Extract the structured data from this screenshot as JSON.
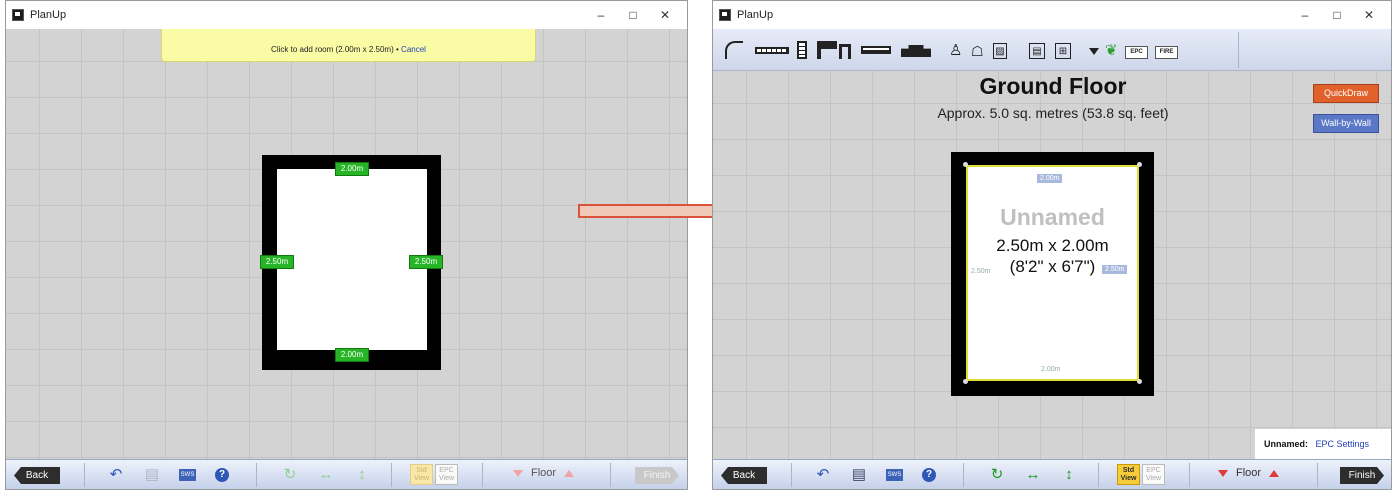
{
  "left_window": {
    "title": "PlanUp",
    "controls": [
      "–",
      "□",
      "✕"
    ],
    "banner": {
      "text": "Click to add room (2.00m x 2.50m)",
      "bullet": "•",
      "cancel": "Cancel"
    },
    "room": {
      "top_label": "2.00m",
      "bottom_label": "2.00m",
      "left_label": "2.50m",
      "right_label": "2.50m"
    },
    "bottom": {
      "back": "Back",
      "std_view": "Std View",
      "epc_view": "EPC View",
      "floor": "Floor",
      "finish": "Finish"
    }
  },
  "right_window": {
    "title": "PlanUp",
    "controls": [
      "–",
      "□",
      "✕"
    ],
    "toolbar": {
      "epc": "EPC",
      "fire": "FIRE"
    },
    "floor_title": "Ground Floor",
    "floor_area": "Approx. 5.0 sq. metres (53.8 sq. feet)",
    "quickdraw": "QuickDraw",
    "wall_by_wall": "Wall-by-Wall",
    "room": {
      "name": "Unnamed",
      "size": "2.50m x 2.00m",
      "size_imperial": "(8'2\" x 6'7\")",
      "top_label": "2.00m",
      "bottom_label": "2.00m",
      "left_label": "2.50m",
      "right_label": "2.50m"
    },
    "epc_panel": {
      "room": "Unnamed:",
      "link": "EPC Settings"
    },
    "bottom": {
      "back": "Back",
      "std_view": "Std View",
      "epc_view": "EPC View",
      "floor": "Floor",
      "finish": "Finish"
    }
  },
  "colors": {
    "accent_green": "#27b527",
    "quickdraw": "#e0622a",
    "wall_by_wall": "#5a78c5",
    "arrow": "#d9533a"
  }
}
